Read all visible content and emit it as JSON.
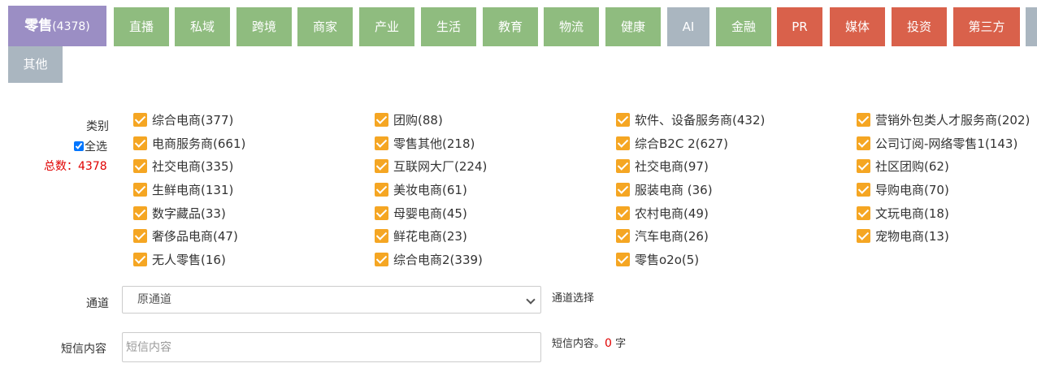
{
  "tabs": [
    {
      "label": "零售",
      "count": "(4378)",
      "color": "#9b8ec4",
      "active": true
    },
    {
      "label": "直播",
      "color": "#8fbc7f"
    },
    {
      "label": "私域",
      "color": "#8fbc7f"
    },
    {
      "label": "跨境",
      "color": "#8fbc7f"
    },
    {
      "label": "商家",
      "color": "#8fbc7f"
    },
    {
      "label": "产业",
      "color": "#8fbc7f"
    },
    {
      "label": "生活",
      "color": "#8fbc7f"
    },
    {
      "label": "教育",
      "color": "#8fbc7f"
    },
    {
      "label": "物流",
      "color": "#8fbc7f"
    },
    {
      "label": "健康",
      "color": "#8fbc7f"
    },
    {
      "label": "AI",
      "color": "#aab6c0"
    },
    {
      "label": "金融",
      "color": "#8fbc7f"
    },
    {
      "label": "PR",
      "color": "#d9614b"
    },
    {
      "label": "媒体",
      "color": "#d9614b"
    },
    {
      "label": "投资",
      "color": "#d9614b"
    },
    {
      "label": "第三方",
      "color": "#d9614b"
    },
    {
      "label": "",
      "color": "#aab6c0"
    },
    {
      "label": "其他",
      "color": "#aab6c0"
    }
  ],
  "form": {
    "category_label": "类别",
    "select_all_label": "全选",
    "total_text": "总数：4378",
    "channel_label": "通道",
    "channel_value": "原通道",
    "channel_hint": "通道选择",
    "sms_label": "短信内容",
    "sms_placeholder": "短信内容",
    "sms_hint_prefix": "短信内容。",
    "sms_count": "0",
    "sms_hint_suffix": "字"
  },
  "categories": [
    [
      "综合电商(377)",
      "团购(88)",
      "软件、设备服务商(432)",
      "营销外包类人才服务商(202)"
    ],
    [
      "电商服务商(661)",
      "零售其他(218)",
      "综合B2C 2(627)",
      "公司订阅-网络零售1(143)"
    ],
    [
      "社交电商(335)",
      "互联网大厂(224)",
      "社交电商(97)",
      "社区团购(62)"
    ],
    [
      "生鲜电商(131)",
      "美妆电商(61)",
      "服装电商 (36)",
      "导购电商(70)"
    ],
    [
      "数字藏品(33)",
      "母婴电商(45)",
      "农村电商(49)",
      "文玩电商(18)"
    ],
    [
      "奢侈品电商(47)",
      "鲜花电商(23)",
      "汽车电商(26)",
      "宠物电商(13)"
    ],
    [
      "无人零售(16)",
      "综合电商2(339)",
      "零售o2o(5)",
      ""
    ]
  ],
  "colors": {
    "checkbox": "#f5a623",
    "total": "#e00000"
  }
}
